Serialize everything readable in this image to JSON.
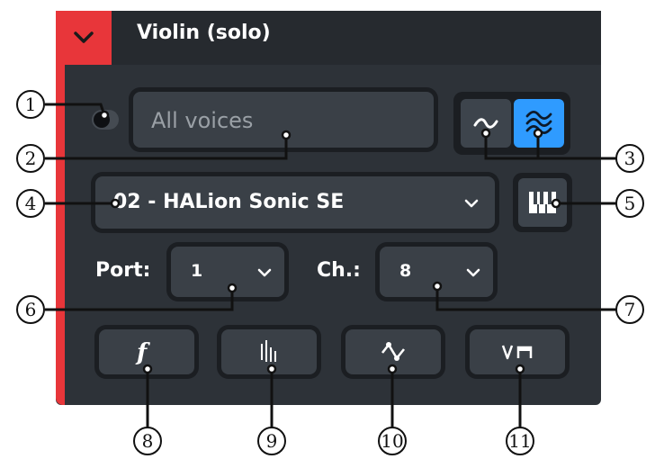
{
  "panel": {
    "title": "Violin (solo)",
    "voice_field": "All voices",
    "device_select": "02 - HALion Sonic SE",
    "port_label": "Port:",
    "port_value": "1",
    "channel_label": "Ch.:",
    "channel_value": "8"
  },
  "callouts": [
    "1",
    "2",
    "3",
    "4",
    "5",
    "6",
    "7",
    "8",
    "9",
    "10",
    "11"
  ],
  "colors": {
    "accent_red": "#e8363a",
    "active_blue": "#2f9bff",
    "panel_bg": "#2d3238"
  }
}
